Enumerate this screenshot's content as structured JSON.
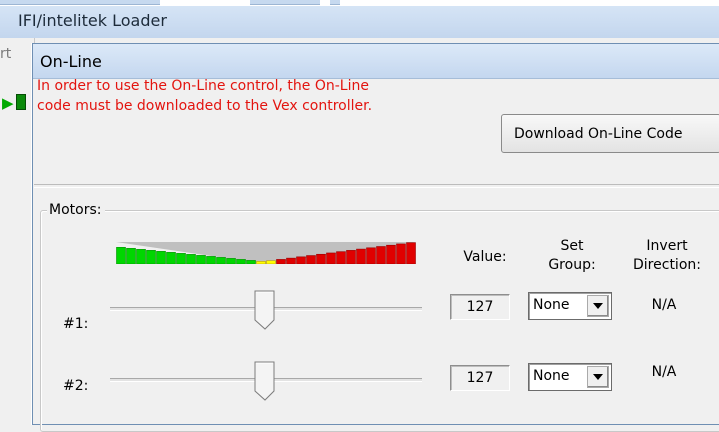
{
  "parent_window": {
    "title": "IFI/intelitek Loader",
    "partial_tab": "rt"
  },
  "dialog": {
    "title": "On-Line",
    "info_lines": [
      "In order to use the On-Line control, the On-Line",
      "code must be downloaded to the Vex controller."
    ],
    "download_button_label": "Download On-Line Code",
    "info_color": "#e3140f"
  },
  "motors": {
    "group_label": "Motors:",
    "headers": {
      "value": "Value:",
      "group_line1": "Set",
      "group_line2": "Group:",
      "invert_line1": "Invert",
      "invert_line2": "Direction:"
    },
    "rows": [
      {
        "label": "#1:",
        "value": "127",
        "group": "None",
        "invert": "N/A",
        "slider_fraction": 0.5
      },
      {
        "label": "#2:",
        "value": "127",
        "group": "None",
        "invert": "N/A",
        "slider_fraction": 0.5
      }
    ]
  },
  "colors": {
    "meter_green": "#00d700",
    "meter_yellow": "#ffff00",
    "meter_red": "#e00000",
    "meter_gray": "#c0c0c0"
  },
  "icons": [
    "dropdown-arrow-icon",
    "slider-thumb-icon"
  ]
}
